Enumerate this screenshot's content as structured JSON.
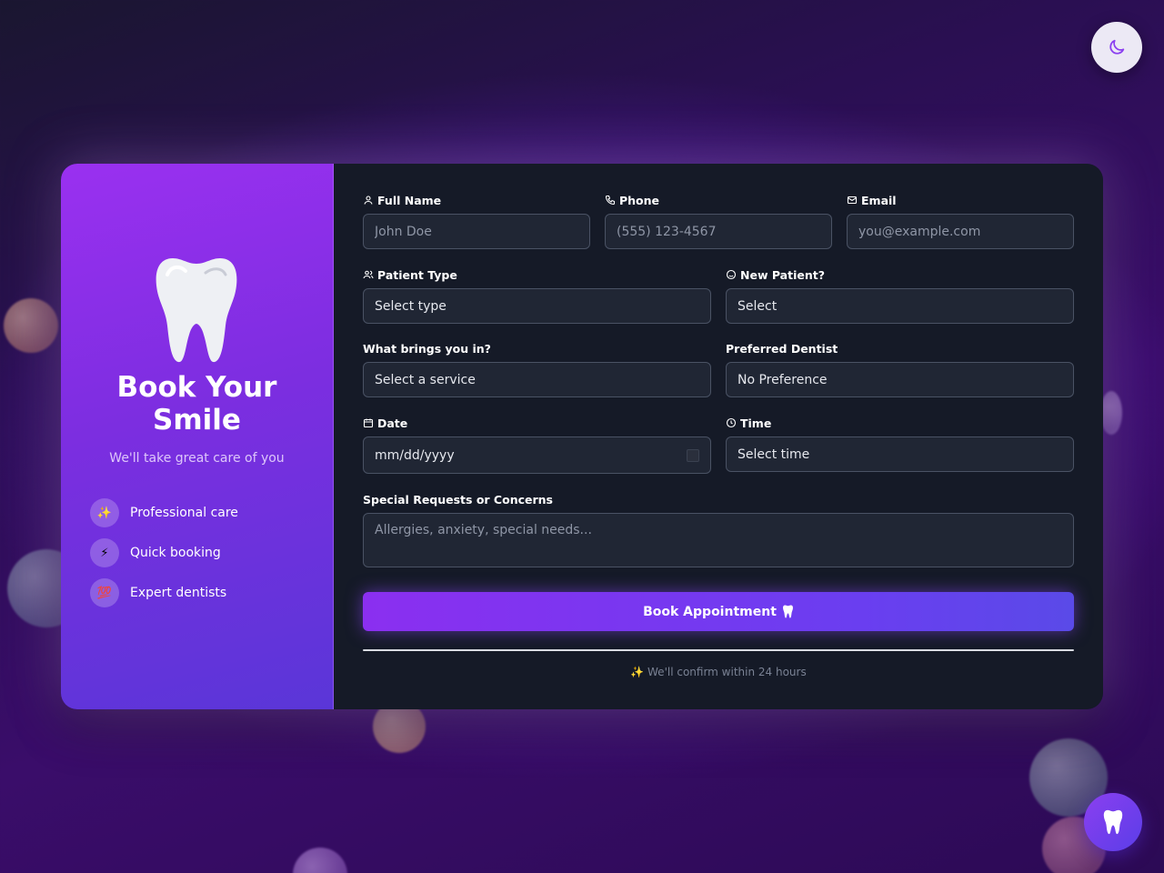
{
  "sidebar": {
    "title_line1": "Book Your",
    "title_line2": "Smile",
    "subtitle": "We'll take great care of you",
    "features": [
      {
        "icon": "sparkles-icon",
        "glyph": "✨",
        "label": "Professional care"
      },
      {
        "icon": "lightning-icon",
        "glyph": "⚡",
        "label": "Quick booking"
      },
      {
        "icon": "heart-icon",
        "glyph": "💯",
        "label": "Expert dentists"
      }
    ]
  },
  "form": {
    "full_name": {
      "label": "Full Name",
      "placeholder": "John Doe"
    },
    "phone": {
      "label": "Phone",
      "placeholder": "(555) 123-4567"
    },
    "email": {
      "label": "Email",
      "placeholder": "you@example.com"
    },
    "patient_type": {
      "label": "Patient Type",
      "value": "Select type"
    },
    "new_patient": {
      "label": "New Patient?",
      "value": "Select"
    },
    "service": {
      "label": "What brings you in?",
      "value": "Select a service"
    },
    "dentist": {
      "label": "Preferred Dentist",
      "value": "No Preference"
    },
    "date": {
      "label": "Date",
      "value": "mm/dd/yyyy"
    },
    "time": {
      "label": "Time",
      "value": "Select time"
    },
    "requests": {
      "label": "Special Requests or Concerns",
      "placeholder": "Allergies, anxiety, special needs..."
    },
    "submit_label": "Book Appointment",
    "confirm_note": "✨ We'll confirm within 24 hours"
  },
  "colors": {
    "accent": "#8b2ff0",
    "panel_bg": "#151a27",
    "input_bg": "#202634"
  }
}
